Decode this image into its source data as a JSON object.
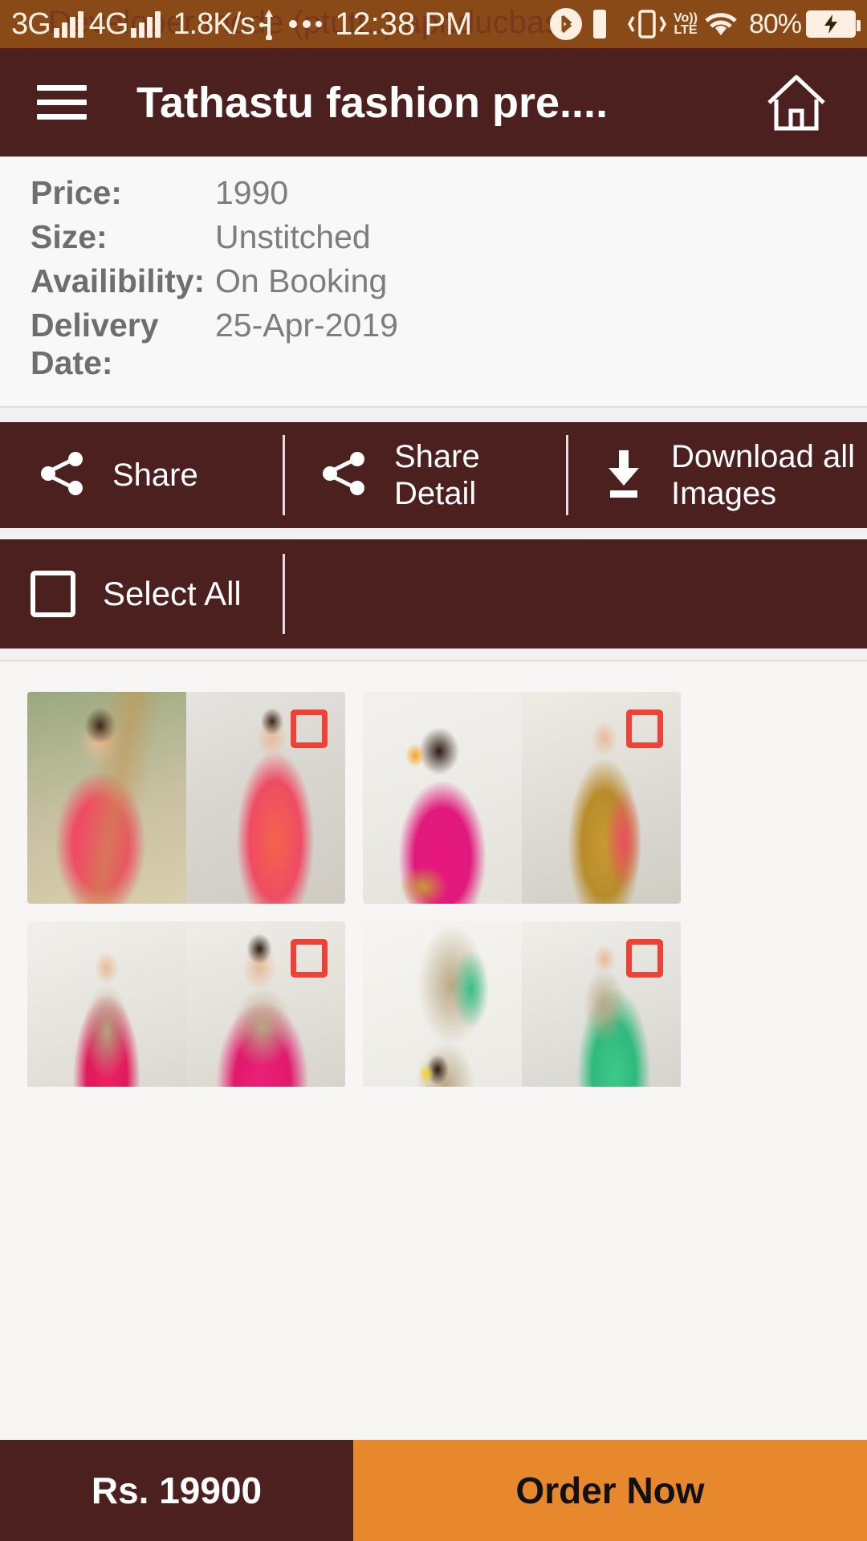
{
  "status_bar": {
    "network_1": "3G",
    "network_2": "4G",
    "data_speed": "1.8K/s",
    "time": "12:38 PM",
    "volte": "Vo)) LTE",
    "battery_percent": "80%",
    "watermark": "Developer mode (ptutt..).apr.ducbase",
    "icons": [
      "signal-bars-icon",
      "signal-bars-icon",
      "usb-icon",
      "more-dots-icon",
      "bluetooth-icon",
      "sim-icon",
      "vibrate-icon",
      "volte-icon",
      "wifi-icon",
      "battery-charging-icon"
    ],
    "background_color": "#8a4a18"
  },
  "app_bar": {
    "title": "Tathastu fashion pre....",
    "menu_icon": "hamburger-menu-icon",
    "home_icon": "home-icon",
    "background_color": "#4d2020"
  },
  "details": {
    "rows": [
      {
        "label": "Price:",
        "value": "1990"
      },
      {
        "label": "Size:",
        "value": "Unstitched"
      },
      {
        "label": "Availibility:",
        "value": "On Booking"
      },
      {
        "label": "Delivery Date:",
        "value": "25-Apr-2019"
      }
    ]
  },
  "share_bar": {
    "share_label": "Share",
    "share_detail_label": "Share Detail",
    "download_label": "Download all Images",
    "share_icon": "share-icon",
    "download_icon": "download-icon"
  },
  "select_bar": {
    "select_all_label": "Select All",
    "checkbox_checked": false,
    "checkbox_icon": "checkbox-unchecked-icon"
  },
  "gallery": {
    "tiles": [
      {
        "id": "tile-1",
        "selected": false,
        "checkbox_icon": "checkbox-unchecked-icon"
      },
      {
        "id": "tile-2",
        "selected": false,
        "checkbox_icon": "checkbox-unchecked-icon"
      },
      {
        "id": "tile-3",
        "selected": false,
        "checkbox_icon": "checkbox-unchecked-icon"
      },
      {
        "id": "tile-4",
        "selected": false,
        "checkbox_icon": "checkbox-unchecked-icon"
      },
      {
        "id": "tile-5",
        "selected": false,
        "checkbox_icon": "checkbox-unchecked-icon"
      },
      {
        "id": "tile-6",
        "selected": false,
        "checkbox_icon": "checkbox-unchecked-icon"
      }
    ]
  },
  "bottom_bar": {
    "price_label": "Rs. 19900",
    "order_label": "Order Now",
    "price_bg": "#4d2020",
    "order_bg": "#e8882c"
  }
}
